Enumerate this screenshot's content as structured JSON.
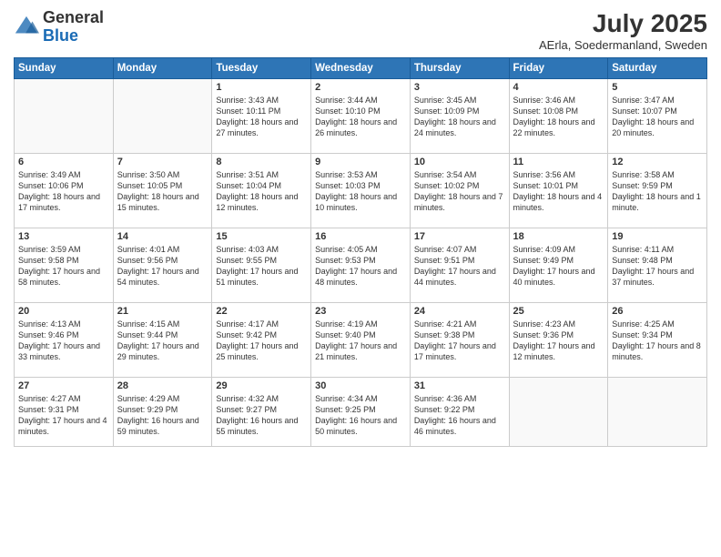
{
  "header": {
    "logo_general": "General",
    "logo_blue": "Blue",
    "month_title": "July 2025",
    "location": "AErla, Soedermanland, Sweden"
  },
  "days_of_week": [
    "Sunday",
    "Monday",
    "Tuesday",
    "Wednesday",
    "Thursday",
    "Friday",
    "Saturday"
  ],
  "weeks": [
    [
      {
        "day": "",
        "content": ""
      },
      {
        "day": "",
        "content": ""
      },
      {
        "day": "1",
        "content": "Sunrise: 3:43 AM\nSunset: 10:11 PM\nDaylight: 18 hours\nand 27 minutes."
      },
      {
        "day": "2",
        "content": "Sunrise: 3:44 AM\nSunset: 10:10 PM\nDaylight: 18 hours\nand 26 minutes."
      },
      {
        "day": "3",
        "content": "Sunrise: 3:45 AM\nSunset: 10:09 PM\nDaylight: 18 hours\nand 24 minutes."
      },
      {
        "day": "4",
        "content": "Sunrise: 3:46 AM\nSunset: 10:08 PM\nDaylight: 18 hours\nand 22 minutes."
      },
      {
        "day": "5",
        "content": "Sunrise: 3:47 AM\nSunset: 10:07 PM\nDaylight: 18 hours\nand 20 minutes."
      }
    ],
    [
      {
        "day": "6",
        "content": "Sunrise: 3:49 AM\nSunset: 10:06 PM\nDaylight: 18 hours\nand 17 minutes."
      },
      {
        "day": "7",
        "content": "Sunrise: 3:50 AM\nSunset: 10:05 PM\nDaylight: 18 hours\nand 15 minutes."
      },
      {
        "day": "8",
        "content": "Sunrise: 3:51 AM\nSunset: 10:04 PM\nDaylight: 18 hours\nand 12 minutes."
      },
      {
        "day": "9",
        "content": "Sunrise: 3:53 AM\nSunset: 10:03 PM\nDaylight: 18 hours\nand 10 minutes."
      },
      {
        "day": "10",
        "content": "Sunrise: 3:54 AM\nSunset: 10:02 PM\nDaylight: 18 hours\nand 7 minutes."
      },
      {
        "day": "11",
        "content": "Sunrise: 3:56 AM\nSunset: 10:01 PM\nDaylight: 18 hours\nand 4 minutes."
      },
      {
        "day": "12",
        "content": "Sunrise: 3:58 AM\nSunset: 9:59 PM\nDaylight: 18 hours\nand 1 minute."
      }
    ],
    [
      {
        "day": "13",
        "content": "Sunrise: 3:59 AM\nSunset: 9:58 PM\nDaylight: 17 hours\nand 58 minutes."
      },
      {
        "day": "14",
        "content": "Sunrise: 4:01 AM\nSunset: 9:56 PM\nDaylight: 17 hours\nand 54 minutes."
      },
      {
        "day": "15",
        "content": "Sunrise: 4:03 AM\nSunset: 9:55 PM\nDaylight: 17 hours\nand 51 minutes."
      },
      {
        "day": "16",
        "content": "Sunrise: 4:05 AM\nSunset: 9:53 PM\nDaylight: 17 hours\nand 48 minutes."
      },
      {
        "day": "17",
        "content": "Sunrise: 4:07 AM\nSunset: 9:51 PM\nDaylight: 17 hours\nand 44 minutes."
      },
      {
        "day": "18",
        "content": "Sunrise: 4:09 AM\nSunset: 9:49 PM\nDaylight: 17 hours\nand 40 minutes."
      },
      {
        "day": "19",
        "content": "Sunrise: 4:11 AM\nSunset: 9:48 PM\nDaylight: 17 hours\nand 37 minutes."
      }
    ],
    [
      {
        "day": "20",
        "content": "Sunrise: 4:13 AM\nSunset: 9:46 PM\nDaylight: 17 hours\nand 33 minutes."
      },
      {
        "day": "21",
        "content": "Sunrise: 4:15 AM\nSunset: 9:44 PM\nDaylight: 17 hours\nand 29 minutes."
      },
      {
        "day": "22",
        "content": "Sunrise: 4:17 AM\nSunset: 9:42 PM\nDaylight: 17 hours\nand 25 minutes."
      },
      {
        "day": "23",
        "content": "Sunrise: 4:19 AM\nSunset: 9:40 PM\nDaylight: 17 hours\nand 21 minutes."
      },
      {
        "day": "24",
        "content": "Sunrise: 4:21 AM\nSunset: 9:38 PM\nDaylight: 17 hours\nand 17 minutes."
      },
      {
        "day": "25",
        "content": "Sunrise: 4:23 AM\nSunset: 9:36 PM\nDaylight: 17 hours\nand 12 minutes."
      },
      {
        "day": "26",
        "content": "Sunrise: 4:25 AM\nSunset: 9:34 PM\nDaylight: 17 hours\nand 8 minutes."
      }
    ],
    [
      {
        "day": "27",
        "content": "Sunrise: 4:27 AM\nSunset: 9:31 PM\nDaylight: 17 hours\nand 4 minutes."
      },
      {
        "day": "28",
        "content": "Sunrise: 4:29 AM\nSunset: 9:29 PM\nDaylight: 16 hours\nand 59 minutes."
      },
      {
        "day": "29",
        "content": "Sunrise: 4:32 AM\nSunset: 9:27 PM\nDaylight: 16 hours\nand 55 minutes."
      },
      {
        "day": "30",
        "content": "Sunrise: 4:34 AM\nSunset: 9:25 PM\nDaylight: 16 hours\nand 50 minutes."
      },
      {
        "day": "31",
        "content": "Sunrise: 4:36 AM\nSunset: 9:22 PM\nDaylight: 16 hours\nand 46 minutes."
      },
      {
        "day": "",
        "content": ""
      },
      {
        "day": "",
        "content": ""
      }
    ]
  ]
}
